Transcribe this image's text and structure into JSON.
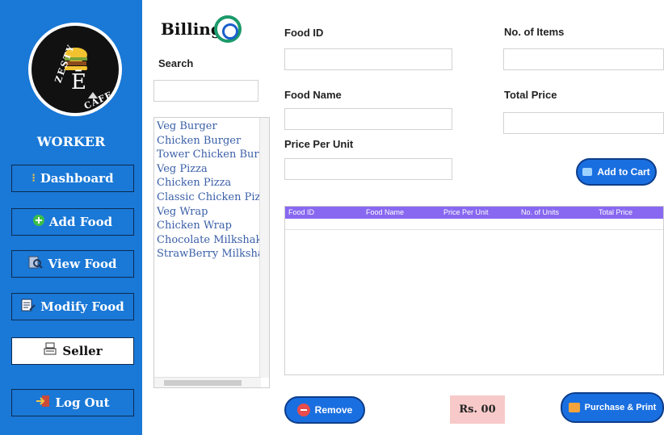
{
  "sidebar": {
    "logo_top": "ZESTY",
    "logo_bottom": "CAFE",
    "role": "WORKER",
    "buttons": [
      {
        "label": "Dashboard",
        "icon": "info-icon"
      },
      {
        "label": "Add Food",
        "icon": "plus-circle-icon"
      },
      {
        "label": "View Food",
        "icon": "search-doc-icon"
      },
      {
        "label": "Modify Food",
        "icon": "edit-icon"
      },
      {
        "label": "Seller",
        "icon": "cash-register-icon"
      },
      {
        "label": "Log Out",
        "icon": "logout-icon"
      }
    ]
  },
  "billing": {
    "title": "Billing",
    "search_label": "Search",
    "items": [
      "Veg Burger",
      "Chicken Burger",
      "Tower Chicken Burge",
      "Veg Pizza",
      "Chicken Pizza",
      "Classic Chicken Pizza",
      "Veg Wrap",
      "Chicken Wrap",
      "Chocolate Milkshake",
      "StrawBerry Milkshak"
    ]
  },
  "form": {
    "food_id_label": "Food ID",
    "items_label": "No. of Items",
    "food_name_label": "Food Name",
    "total_price_label": "Total Price",
    "price_label": "Price Per Unit",
    "add_to_cart": "Add to Cart"
  },
  "table": {
    "columns": [
      "Food ID",
      "Food Name",
      "Price Per Unit",
      "No. of Units",
      "Total Price"
    ]
  },
  "footer": {
    "remove": "Remove",
    "total": "Rs. 00",
    "purchase": "Purchase & Print"
  },
  "colors": {
    "sidebar": "#1a78d6",
    "table_header": "#8868f0",
    "button": "#1a6fe0",
    "total_bg": "#f7c9c9"
  }
}
